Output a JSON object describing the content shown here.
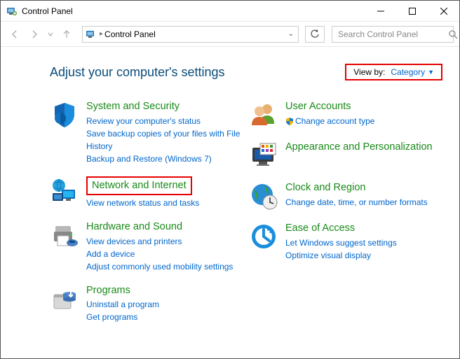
{
  "window": {
    "title": "Control Panel"
  },
  "address": {
    "location": "Control Panel"
  },
  "search": {
    "placeholder": "Search Control Panel"
  },
  "header": {
    "heading": "Adjust your computer's settings",
    "viewby_label": "View by:",
    "viewby_value": "Category"
  },
  "left": [
    {
      "title": "System and Security",
      "links": [
        "Review your computer's status",
        "Save backup copies of your files with File History",
        "Backup and Restore (Windows 7)"
      ]
    },
    {
      "title": "Network and Internet",
      "links": [
        "View network status and tasks"
      ]
    },
    {
      "title": "Hardware and Sound",
      "links": [
        "View devices and printers",
        "Add a device",
        "Adjust commonly used mobility settings"
      ]
    },
    {
      "title": "Programs",
      "links": [
        "Uninstall a program",
        "Get programs"
      ]
    }
  ],
  "right": [
    {
      "title": "User Accounts",
      "links": [
        "Change account type"
      ],
      "shield_first": true
    },
    {
      "title": "Appearance and Personalization",
      "links": []
    },
    {
      "title": "Clock and Region",
      "links": [
        "Change date, time, or number formats"
      ]
    },
    {
      "title": "Ease of Access",
      "links": [
        "Let Windows suggest settings",
        "Optimize visual display"
      ]
    }
  ]
}
